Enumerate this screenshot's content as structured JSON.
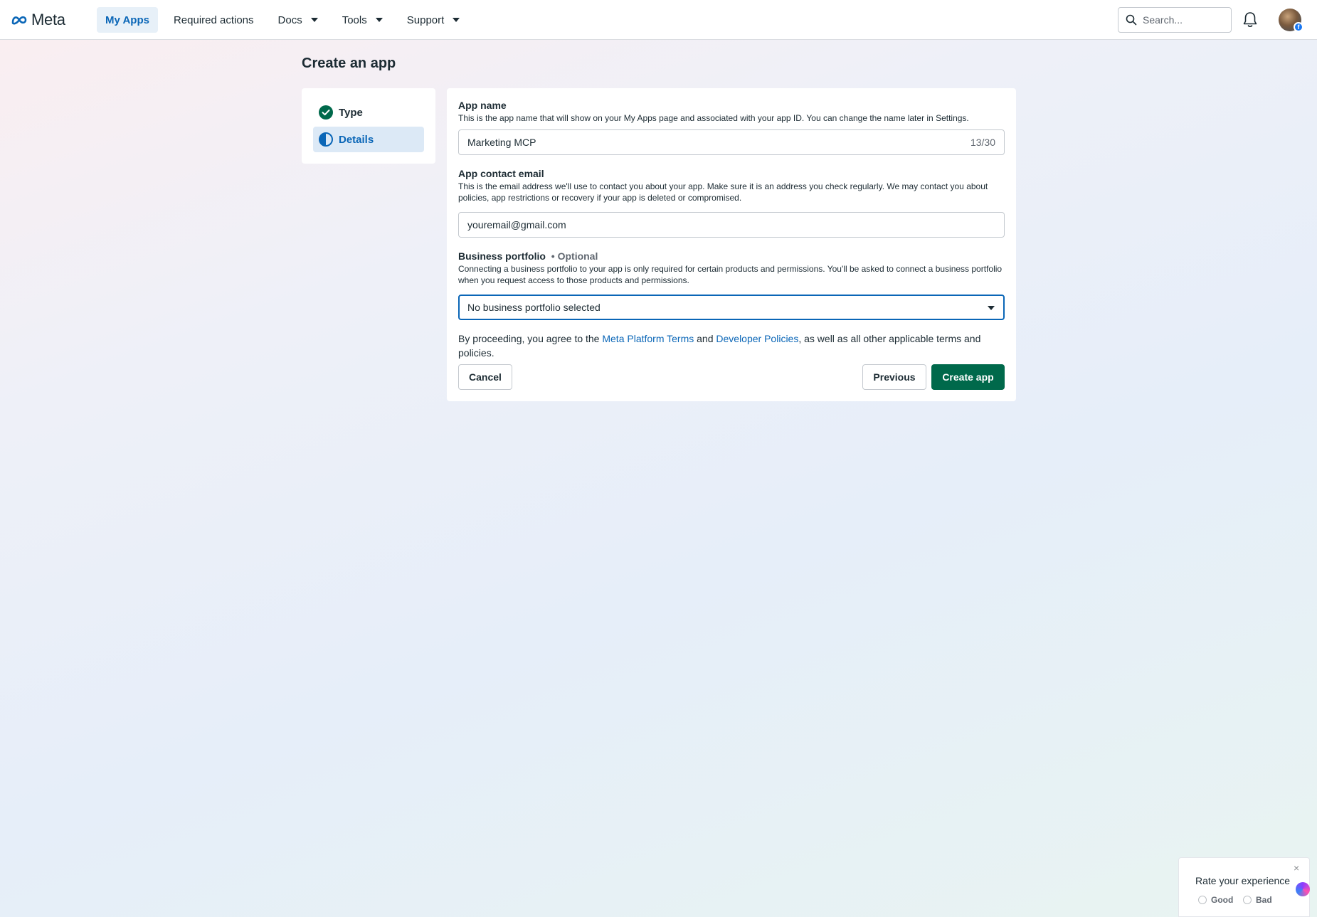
{
  "brand": {
    "name": "Meta"
  },
  "nav": {
    "items": [
      {
        "label": "My Apps",
        "active": true
      },
      {
        "label": "Required actions"
      },
      {
        "label": "Docs",
        "dropdown": true
      },
      {
        "label": "Tools",
        "dropdown": true
      },
      {
        "label": "Support",
        "dropdown": true
      }
    ],
    "search_placeholder": "Search..."
  },
  "page": {
    "title": "Create an app"
  },
  "steps": [
    {
      "label": "Type",
      "status": "complete"
    },
    {
      "label": "Details",
      "status": "current"
    }
  ],
  "form": {
    "app_name": {
      "label": "App name",
      "help": "This is the app name that will show on your My Apps page and associated with your app ID. You can change the name later in Settings.",
      "value": "Marketing MCP",
      "counter": "13/30"
    },
    "contact_email": {
      "label": "App contact email",
      "help": "This is the email address we'll use to contact you about your app. Make sure it is an address you check regularly. We may contact you about policies, app restrictions or recovery if your app is deleted or compromised.",
      "value": "youremail@gmail.com"
    },
    "business_portfolio": {
      "label": "Business portfolio",
      "optional": "• Optional",
      "help": "Connecting a business portfolio to your app is only required for certain products and permissions. You'll be asked to connect a business portfolio when you request access to those products and permissions.",
      "selected": "No business portfolio selected"
    },
    "terms": {
      "prefix": "By proceeding, you agree to the ",
      "link1": "Meta Platform Terms",
      "middle": " and ",
      "link2": "Developer Policies",
      "suffix": ", as well as all other applicable terms and policies."
    },
    "buttons": {
      "cancel": "Cancel",
      "previous": "Previous",
      "create": "Create app"
    }
  },
  "rating": {
    "title": "Rate your experience",
    "close": "×",
    "good": "Good",
    "bad": "Bad"
  },
  "colors": {
    "accent": "#0a66b7",
    "primary_button": "#00694b",
    "step_complete": "#00694b"
  }
}
